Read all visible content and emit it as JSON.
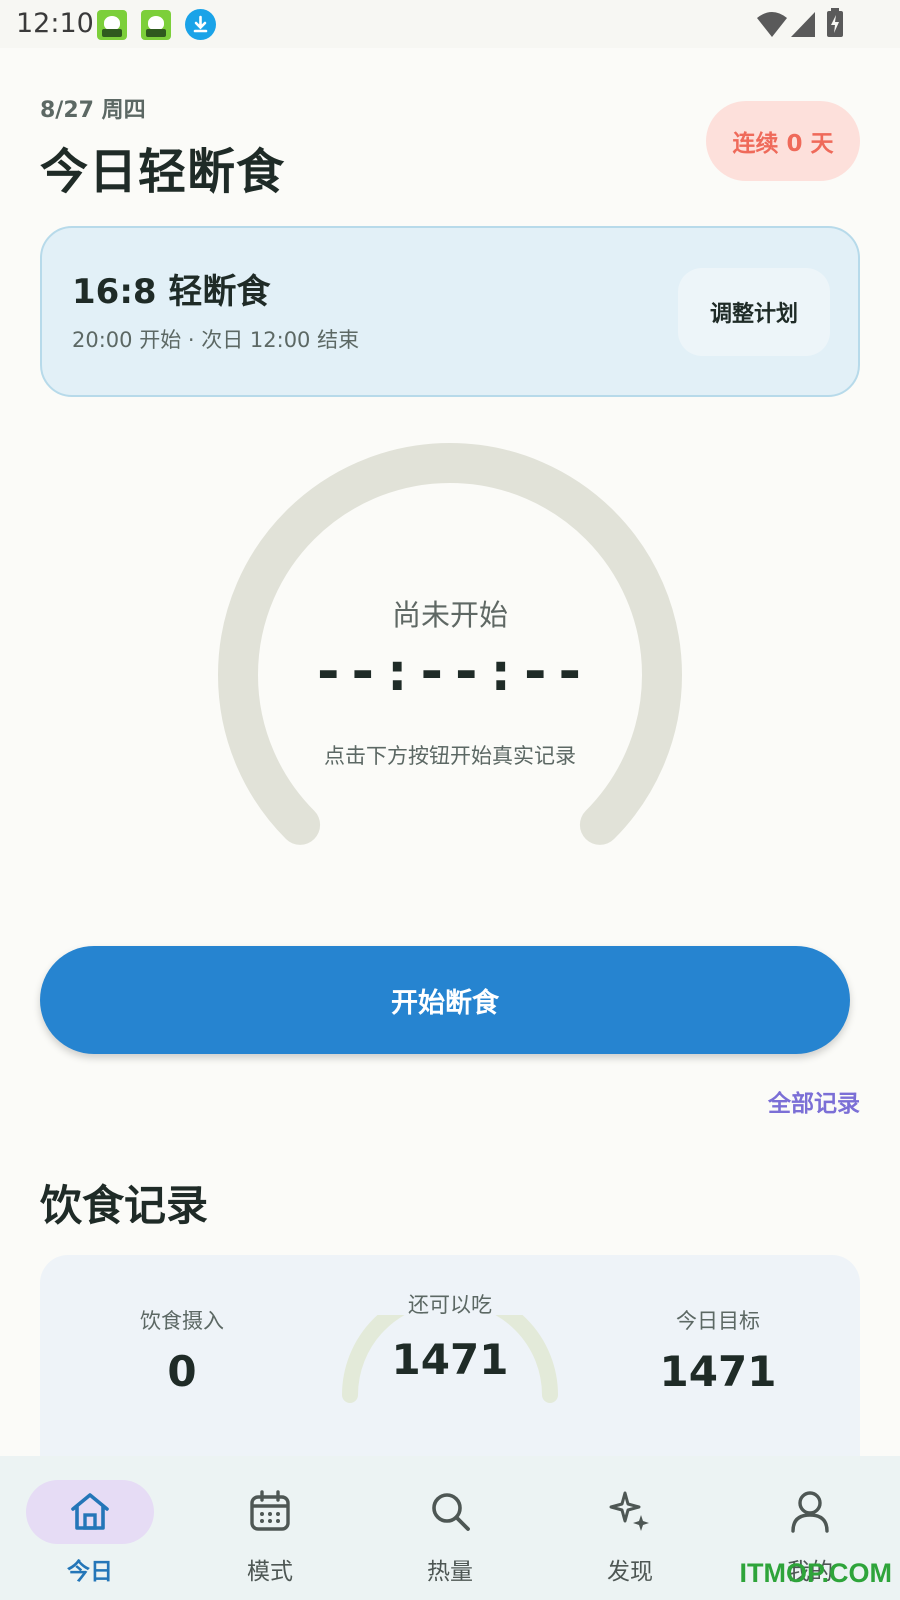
{
  "status_bar": {
    "time": "12:10",
    "icons": [
      "app-icon",
      "app-icon",
      "download-icon",
      "wifi-icon",
      "signal-icon",
      "battery-charging-icon"
    ]
  },
  "header": {
    "date": "8/27 周四",
    "title": "今日轻断食",
    "streak": "连续 0 天"
  },
  "plan": {
    "title": "16:8 轻断食",
    "subtitle": "20:00 开始 · 次日 12:00 结束",
    "adjust_label": "调整计划"
  },
  "timer": {
    "status": "尚未开始",
    "time": "--:--:--",
    "hint": "点击下方按钮开始真实记录",
    "progress": 0
  },
  "actions": {
    "start_label": "开始断食",
    "all_records_label": "全部记录"
  },
  "diet": {
    "section_title": "饮食记录",
    "intake_label": "饮食摄入",
    "intake_value": "0",
    "remaining_label": "还可以吃",
    "remaining_value": "1471",
    "target_label": "今日目标",
    "target_value": "1471"
  },
  "nav": {
    "items": [
      {
        "label": "今日",
        "icon": "home-icon",
        "active": true
      },
      {
        "label": "模式",
        "icon": "calendar-icon",
        "active": false
      },
      {
        "label": "热量",
        "icon": "search-icon",
        "active": false
      },
      {
        "label": "发现",
        "icon": "sparkle-icon",
        "active": false
      },
      {
        "label": "我的",
        "icon": "person-icon",
        "active": false
      }
    ]
  },
  "watermark": "ITMOP.COM",
  "colors": {
    "accent_blue": "#2684d0",
    "streak_text": "#ef6a5a",
    "streak_bg": "#fde0db",
    "plan_bg": "#e2f0f7",
    "ring_track": "#e1e2d8",
    "link_purple": "#7b6fd6",
    "nav_active_bg": "#e6dcf5"
  }
}
